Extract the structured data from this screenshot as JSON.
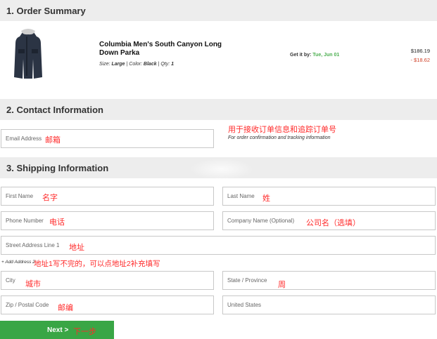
{
  "sections": {
    "order_summary": "1. Order Summary",
    "contact": "2. Contact Information",
    "shipping": "3. Shipping Information"
  },
  "product": {
    "name": "Columbia Men's South Canyon Long Down Parka",
    "size_label": "Size:",
    "size": "Large",
    "color_label": "| Color:",
    "color": "Black",
    "qty_label": "| Qty:",
    "qty": "1",
    "get_it_label": "Get it by:",
    "get_it_date": "Tue, Jun 01",
    "price": "$186.19",
    "discount": "- $18.62"
  },
  "contact": {
    "email_placeholder": "Email Address",
    "email_cn": "邮箱",
    "note_cn": "用于接收订单信息和追踪订单号",
    "note_en": "For order confirmation and tracking information"
  },
  "shipping": {
    "first_name": "First Name",
    "first_name_cn": "名字",
    "last_name": "Last Name",
    "last_name_cn": "姓",
    "phone": "Phone Number",
    "phone_cn": "电话",
    "company": "Company Name (Optional)",
    "company_cn": "公司名（选填）",
    "street": "Street Address Line 1",
    "street_cn": "地址",
    "add_address": "+ Add Address 2",
    "add_address_cn": "地址1写不完的，可以点地址2补充填写",
    "city": "City",
    "city_cn": "城市",
    "state": "State / Province",
    "state_cn": "周",
    "zip": "Zip / Postal Code",
    "zip_cn": "邮编",
    "country": "United States"
  },
  "next": {
    "label": "Next >",
    "cn": "下一步"
  },
  "colors": {
    "section_bg": "#ededed",
    "green": "#39a645",
    "annotation_red": "#ff2a2a",
    "discount_red": "#d0432a"
  }
}
